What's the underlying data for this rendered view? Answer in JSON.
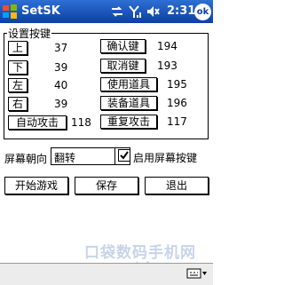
{
  "titlebar": {
    "title": "SetSK",
    "time": "2:31",
    "ok": "ok"
  },
  "icons": [
    "windows-logo",
    "connectivity",
    "signal",
    "volume",
    "keyboard-sip"
  ],
  "keyset": {
    "group_label": "设置按键",
    "left": [
      {
        "label": "上",
        "value": "37"
      },
      {
        "label": "下",
        "value": "39"
      },
      {
        "label": "左",
        "value": "40"
      },
      {
        "label": "右",
        "value": "39"
      },
      {
        "label": "自动攻击",
        "value": "118"
      }
    ],
    "right": [
      {
        "label": "确认键",
        "value": "194"
      },
      {
        "label": "取消键",
        "value": "193"
      },
      {
        "label": "使用道具",
        "value": "195"
      },
      {
        "label": "装备道具",
        "value": "196"
      },
      {
        "label": "重复攻击",
        "value": "117"
      }
    ]
  },
  "orientation": {
    "label": "屏幕朝向",
    "selected": "翻转"
  },
  "screen_keys": {
    "label": "启用屏幕按键",
    "checked": true
  },
  "actions": {
    "start": "开始游戏",
    "save": "保存",
    "exit": "退出"
  },
  "watermark": {
    "line1": "口袋数码手机网",
    "line2": "www.pdafans.com"
  }
}
